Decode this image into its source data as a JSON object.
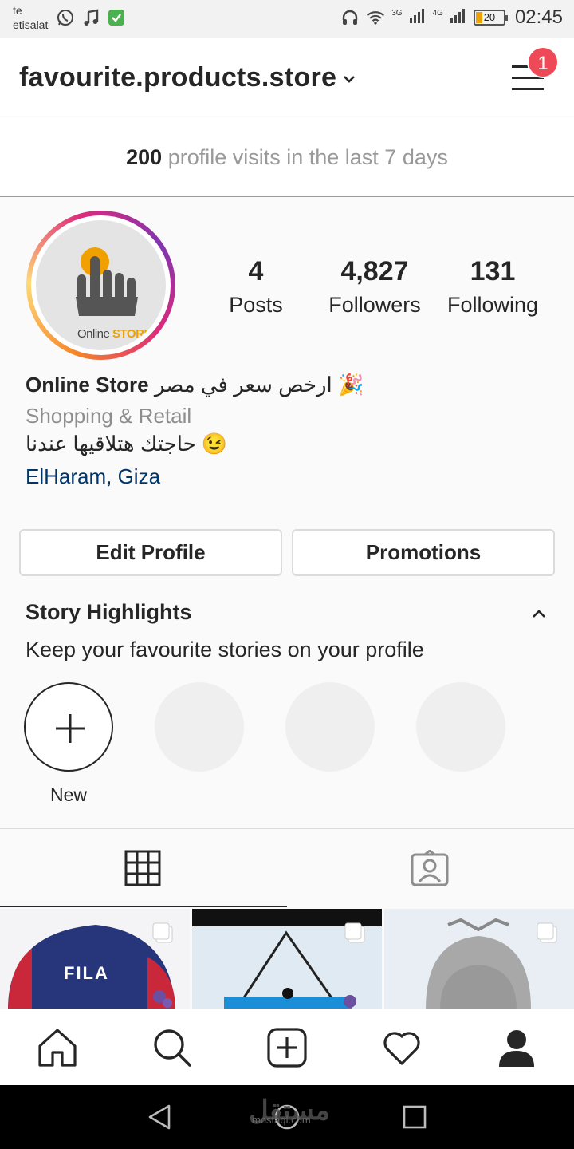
{
  "status_bar": {
    "carrier_line1": "te",
    "carrier_line2": "etisalat",
    "network_1": "3G",
    "network_2": "4G",
    "battery": "20",
    "time": "02:45"
  },
  "header": {
    "username": "favourite.products.store",
    "notification_count": "1"
  },
  "insights": {
    "count": "200",
    "text": " profile visits in the last 7 days"
  },
  "avatar": {
    "logo_text_1": "Online ",
    "logo_text_2": "STORE"
  },
  "stats": [
    {
      "value": "4",
      "label": "Posts"
    },
    {
      "value": "4,827",
      "label": "Followers"
    },
    {
      "value": "131",
      "label": "Following"
    }
  ],
  "bio": {
    "name": "Online Store",
    "name_arabic": " ارخص سعر في مصر 🎉",
    "category": "Shopping & Retail",
    "text": "حاجتك هتلاقيها عندنا 😉",
    "location": "ElHaram, Giza"
  },
  "buttons": {
    "edit_profile": "Edit Profile",
    "promotions": "Promotions"
  },
  "highlights": {
    "title": "Story Highlights",
    "subtitle": "Keep your favourite stories on your profile",
    "new_label": "New"
  },
  "posts": [
    {
      "brand_text": "FILA"
    },
    {
      "brand_text": ""
    },
    {
      "brand_text": ""
    }
  ],
  "watermark": {
    "text": "مستقل",
    "domain": "mostaql.com"
  },
  "colors": {
    "accent_blue": "#003569",
    "badge_red": "#ed4956",
    "muted_gray": "#8e8e8e"
  },
  "icons": {
    "grid_tab": "grid-icon",
    "tagged_tab": "tagged-icon",
    "nav": [
      "home-icon",
      "search-icon",
      "add-post-icon",
      "heart-icon",
      "profile-icon"
    ]
  }
}
